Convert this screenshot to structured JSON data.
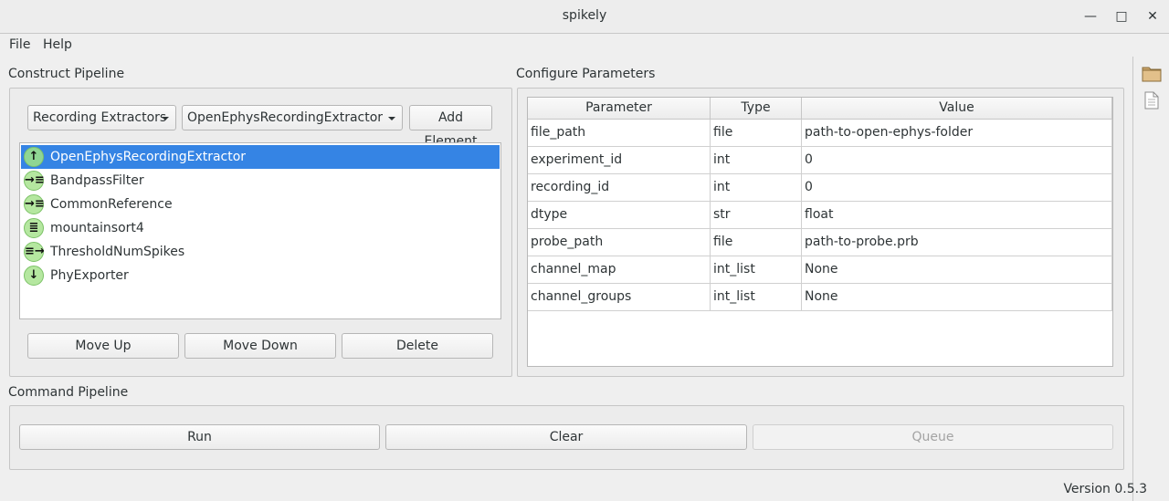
{
  "window": {
    "title": "spikely",
    "minimize_glyph": "—",
    "maximize_glyph": "□",
    "close_glyph": "✕"
  },
  "menu": {
    "file": "File",
    "help": "Help"
  },
  "construct": {
    "title": "Construct Pipeline",
    "category_select": "Recording Extractors",
    "element_select": "OpenEphysRecordingExtractor",
    "add_label": "Add Element",
    "items": [
      {
        "label": "OpenEphysRecordingExtractor",
        "icon": "arrow-up-icon",
        "glyph": "↑"
      },
      {
        "label": "BandpassFilter",
        "icon": "arrow-right-bars-icon",
        "glyph": "→≡"
      },
      {
        "label": "CommonReference",
        "icon": "arrow-right-bars-icon",
        "glyph": "→≡"
      },
      {
        "label": "mountainsort4",
        "icon": "bars-icon",
        "glyph": "≣"
      },
      {
        "label": "ThresholdNumSpikes",
        "icon": "bars-arrow-right-icon",
        "glyph": "≡→"
      },
      {
        "label": "PhyExporter",
        "icon": "arrow-down-icon",
        "glyph": "↓"
      }
    ],
    "move_up": "Move Up",
    "move_down": "Move Down",
    "delete": "Delete"
  },
  "configure": {
    "title": "Configure Parameters",
    "headers": [
      "Parameter",
      "Type",
      "Value"
    ],
    "rows": [
      [
        "file_path",
        "file",
        "path-to-open-ephys-folder"
      ],
      [
        "experiment_id",
        "int",
        "0"
      ],
      [
        "recording_id",
        "int",
        "0"
      ],
      [
        "dtype",
        "str",
        "float"
      ],
      [
        "probe_path",
        "file",
        "path-to-probe.prb"
      ],
      [
        "channel_map",
        "int_list",
        "None"
      ],
      [
        "channel_groups",
        "int_list",
        "None"
      ]
    ]
  },
  "command": {
    "title": "Command Pipeline",
    "run": "Run",
    "clear": "Clear",
    "queue": "Queue"
  },
  "version": "Version 0.5.3",
  "colors": {
    "selection": "#3584e4",
    "icon_green": "#b5e7a0"
  }
}
